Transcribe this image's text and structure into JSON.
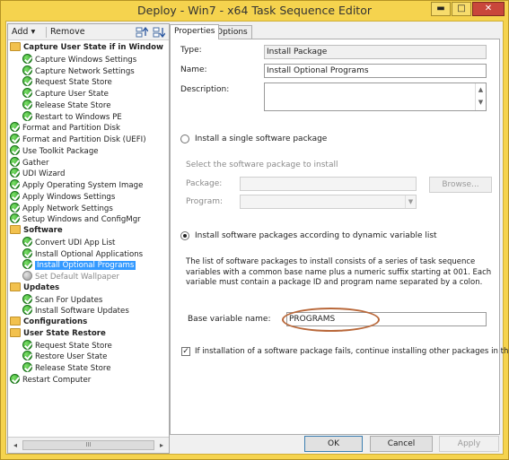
{
  "window": {
    "title": "Deploy - Win7 - x64 Task Sequence Editor",
    "minimize": "▬",
    "maximize": "□",
    "close": "✕"
  },
  "toolbar": {
    "add": "Add",
    "add_arrow": "▾",
    "remove": "Remove"
  },
  "tree": [
    {
      "label": "Capture User State if in Window",
      "kind": "folder",
      "group": true,
      "indent": 0
    },
    {
      "label": "Capture Windows Settings",
      "kind": "ok",
      "indent": 1
    },
    {
      "label": "Capture Network Settings",
      "kind": "ok",
      "indent": 1
    },
    {
      "label": "Request State Store",
      "kind": "ok",
      "indent": 1
    },
    {
      "label": "Capture User State",
      "kind": "ok",
      "indent": 1
    },
    {
      "label": "Release State Store",
      "kind": "ok",
      "indent": 1
    },
    {
      "label": "Restart to Windows PE",
      "kind": "ok",
      "indent": 1
    },
    {
      "label": "Format and Partition Disk",
      "kind": "ok",
      "indent": 0
    },
    {
      "label": "Format and Partition Disk (UEFI)",
      "kind": "ok",
      "indent": 0
    },
    {
      "label": "Use Toolkit Package",
      "kind": "ok",
      "indent": 0
    },
    {
      "label": "Gather",
      "kind": "ok",
      "indent": 0
    },
    {
      "label": "UDI Wizard",
      "kind": "ok",
      "indent": 0
    },
    {
      "label": "Apply Operating System Image",
      "kind": "ok",
      "indent": 0
    },
    {
      "label": "Apply Windows Settings",
      "kind": "ok",
      "indent": 0
    },
    {
      "label": "Apply Network Settings",
      "kind": "ok",
      "indent": 0
    },
    {
      "label": "Setup Windows and ConfigMgr",
      "kind": "ok",
      "indent": 0
    },
    {
      "label": "Software",
      "kind": "folder",
      "group": true,
      "indent": 0
    },
    {
      "label": "Convert UDI App List",
      "kind": "ok",
      "indent": 1
    },
    {
      "label": "Install Optional Applications",
      "kind": "ok",
      "indent": 1
    },
    {
      "label": "Install Optional Programs",
      "kind": "ok",
      "indent": 1,
      "selected": true
    },
    {
      "label": "Set Default Wallpaper",
      "kind": "off",
      "indent": 1,
      "disabled": true
    },
    {
      "label": "Updates",
      "kind": "folder",
      "group": true,
      "indent": 0
    },
    {
      "label": "Scan For Updates",
      "kind": "ok",
      "indent": 1
    },
    {
      "label": "Install Software Updates",
      "kind": "ok",
      "indent": 1
    },
    {
      "label": "Configurations",
      "kind": "folder",
      "group": true,
      "indent": 0
    },
    {
      "label": "User State Restore",
      "kind": "folder",
      "group": true,
      "indent": 0
    },
    {
      "label": "Request State Store",
      "kind": "ok",
      "indent": 1
    },
    {
      "label": "Restore User State",
      "kind": "ok",
      "indent": 1
    },
    {
      "label": "Release State Store",
      "kind": "ok",
      "indent": 1
    },
    {
      "label": "Restart Computer",
      "kind": "ok",
      "indent": 0
    }
  ],
  "scrollbar": {
    "left": "◂",
    "right": "▸",
    "thumb": "III"
  },
  "tabs": {
    "properties": "Properties",
    "options": "Options"
  },
  "props": {
    "type_label": "Type:",
    "type_value": "Install Package",
    "name_label": "Name:",
    "name_value": "Install Optional Programs",
    "description_label": "Description:",
    "description_value": "",
    "radio_single": "Install a single software package",
    "select_pkg": "Select the software package to install",
    "package_label": "Package:",
    "program_label": "Program:",
    "browse": "Browse...",
    "radio_dynamic": "Install software packages according to dynamic variable list",
    "dynamic_desc": "The list of software packages to install consists of a series of task sequence variables with a common base name plus a numeric suffix starting at 001.  Each variable must contain a package ID and program name separated by a colon.",
    "base_var_label": "Base variable name:",
    "base_var_value": "PROGRAMS",
    "continue_check": "If installation of a software package fails, continue installing other packages in the list"
  },
  "buttons": {
    "ok": "OK",
    "cancel": "Cancel",
    "apply": "Apply"
  }
}
